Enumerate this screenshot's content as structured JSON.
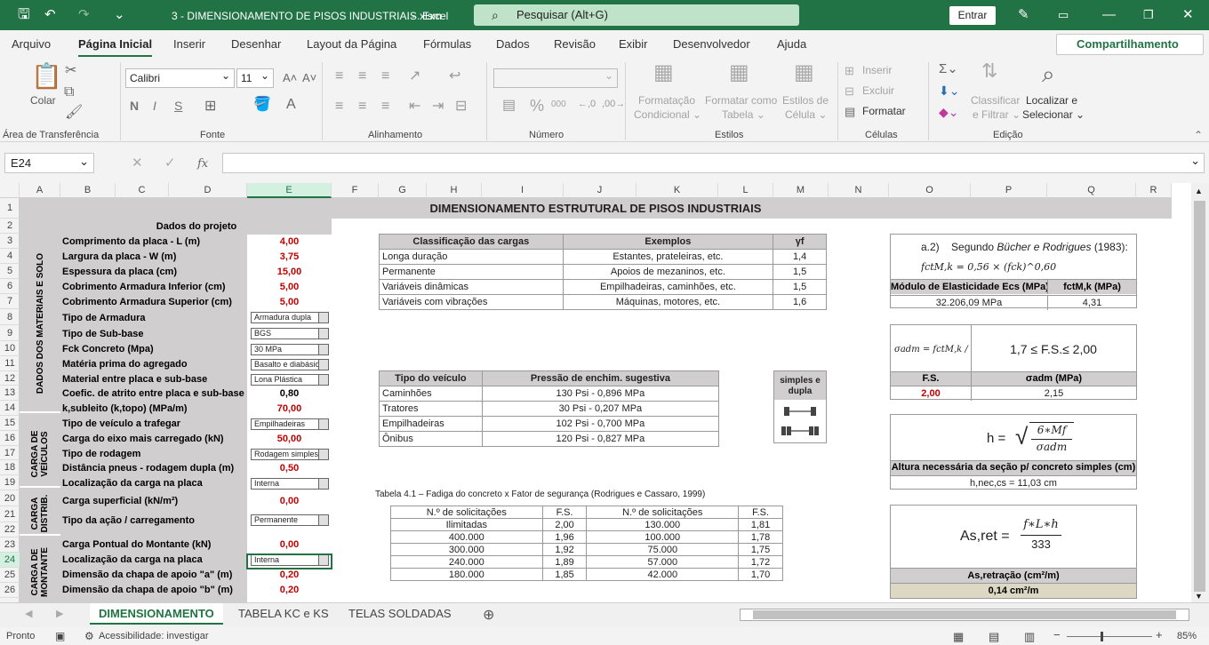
{
  "title": {
    "file": "3 - DIMENSIONAMENTO DE PISOS INDUSTRIAIS.xlsm",
    "sep": "-",
    "app": "Excel",
    "search": "Pesquisar (Alt+G)",
    "entrar": "Entrar"
  },
  "menu": [
    "Arquivo",
    "Página Inicial",
    "Inserir",
    "Desenhar",
    "Layout da Página",
    "Fórmulas",
    "Dados",
    "Revisão",
    "Exibir",
    "Desenvolvedor",
    "Ajuda"
  ],
  "share": "Compartilhamento",
  "ribbon": {
    "colar": "Colar",
    "font": "Calibri",
    "size": "11",
    "bold": "N",
    "italic": "I",
    "underline": "S",
    "pct": "%",
    "thousands": "000",
    "fmt_cond": [
      "Formatação",
      "Condicional ⌄"
    ],
    "fmt_tab": [
      "Formatar como",
      "Tabela ⌄"
    ],
    "styles": [
      "Estilos de",
      "Célula ⌄"
    ],
    "inserir": "Inserir",
    "excluir": "Excluir",
    "formatar": "Formatar",
    "classificar": [
      "Classificar",
      "e Filtrar ⌄"
    ],
    "localizar": [
      "Localizar e",
      "Selecionar ⌄"
    ],
    "groups": [
      "Área de Transferência",
      "Fonte",
      "Alinhamento",
      "Número",
      "Estilos",
      "Células",
      "Edição"
    ]
  },
  "namebox": "E24",
  "fx": "fx",
  "columns": [
    "A",
    "B",
    "C",
    "D",
    "E",
    "F",
    "G",
    "H",
    "I",
    "J",
    "K",
    "L",
    "M",
    "N",
    "O",
    "P",
    "Q",
    "R"
  ],
  "rows": [
    "1",
    "2",
    "3",
    "4",
    "5",
    "6",
    "7",
    "8",
    "9",
    "10",
    "11",
    "12",
    "13",
    "14",
    "15",
    "16",
    "17",
    "18",
    "19",
    "20",
    "21",
    "22",
    "23",
    "24",
    "25",
    "26"
  ],
  "sheet": {
    "main_title": "DIMENSIONAMENTO ESTRUTURAL DE PISOS INDUSTRIAIS",
    "project_header": "Dados do projeto",
    "side_materials": "DADOS DOS MATERIAIS E SOLO",
    "side_vehicles": "CARGA DE VEÍCULOS",
    "side_distrib": "CARGA DISTRIB.",
    "side_montante": "CARGA DE MONTANTE",
    "inputs": [
      {
        "label": "Comprimento da placa - L (m)",
        "value": "4,00"
      },
      {
        "label": "Largura da placa - W (m)",
        "value": "3,75"
      },
      {
        "label": "Espessura da placa (cm)",
        "value": "15,00"
      },
      {
        "label": "Cobrimento Armadura Inferior (cm)",
        "value": "5,00"
      },
      {
        "label": "Cobrimento Armadura Superior (cm)",
        "value": "5,00"
      },
      {
        "label": "Tipo de Armadura",
        "dropdown": "Armadura dupla"
      },
      {
        "label": "Tipo de Sub-base",
        "dropdown": "BGS"
      },
      {
        "label": "Fck Concreto (Mpa)",
        "dropdown": "30 MPa"
      },
      {
        "label": "Matéria prima do agregado",
        "dropdown": "Basalto e diabásio"
      },
      {
        "label": "Material entre placa e sub-base",
        "dropdown": "Lona Plástica"
      },
      {
        "label": "Coefic. de atrito entre placa e sub-base",
        "value": "0,80",
        "black": true
      },
      {
        "label": "k,subleito (k,topo) (MPa/m)",
        "value": "70,00"
      },
      {
        "label": "Tipo de veículo a trafegar",
        "dropdown": "Empilhadeiras"
      },
      {
        "label": "Carga do eixo mais carregado (kN)",
        "value": "50,00"
      },
      {
        "label": "Tipo de rodagem",
        "dropdown": "Rodagem simples"
      },
      {
        "label": "Distância pneus - rodagem dupla (m)",
        "value": "0,50"
      },
      {
        "label": "Localização da carga na placa",
        "dropdown": "Interna"
      },
      {
        "label": "Carga superficial (kN/m²)",
        "value": "0,00"
      },
      {
        "label": "Tipo da ação / carregamento",
        "dropdown": "Permanente"
      },
      {
        "label": "Carga Pontual do Montante (kN)",
        "value": "0,00"
      },
      {
        "label": "Localização da carga na placa",
        "dropdown": "Interna"
      },
      {
        "label": "Dimensão da chapa de apoio \"a\" (m)",
        "value": "0,20"
      },
      {
        "label": "Dimensão da chapa de apoio \"b\" (m)",
        "value": "0,20"
      }
    ],
    "class_table": {
      "headers": [
        "Classificação das cargas",
        "Exemplos",
        "γf"
      ],
      "rows": [
        [
          "Longa duração",
          "Estantes, prateleiras, etc.",
          "1,4"
        ],
        [
          "Permanente",
          "Apoios de mezaninos, etc.",
          "1,5"
        ],
        [
          "Variáveis dinâmicas",
          "Empilhadeiras, caminhões, etc.",
          "1,5"
        ],
        [
          "Variáveis com vibrações",
          "Máquinas,  motores, etc.",
          "1,6"
        ]
      ]
    },
    "vehicle_table": {
      "headers": [
        "Tipo do veículo",
        "Pressão de enchim. sugestiva"
      ],
      "rows": [
        [
          "Caminhões",
          "130 Psi - 0,896 MPa"
        ],
        [
          "Tratores",
          "30 Psi - 0,207 MPa"
        ],
        [
          "Empilhadeiras",
          "102 Psi - 0,700 MPa"
        ],
        [
          "Ônibus",
          "120 Psi - 0,827 MPa"
        ]
      ]
    },
    "wheel_box": "simples e dupla",
    "fatigue_title": "Tabela 4.1 – Fadiga do concreto x Fator de segurança (Rodrigues e Cassaro, 1999)",
    "fatigue_table": {
      "headers": [
        "N.º de solicitações",
        "F.S.",
        "N.º de solicitações",
        "F.S."
      ],
      "rows": [
        [
          "Ilimitadas",
          "2,00",
          "130.000",
          "1,81"
        ],
        [
          "400.000",
          "1,96",
          "100.000",
          "1,78"
        ],
        [
          "300.000",
          "1,92",
          "75.000",
          "1,75"
        ],
        [
          "240.000",
          "1,89",
          "57.000",
          "1,72"
        ],
        [
          "180.000",
          "1,85",
          "42.000",
          "1,70"
        ]
      ]
    },
    "panel_a": {
      "heading": "a.2)",
      "heading_text": "Segundo",
      "authors": "Bücher e Rodrigues",
      "year": "(1983):",
      "formula": "fctM,k = 0,56 × (fck)^0,60",
      "h1": "Módulo de Elasticidade Ecs (MPa)",
      "h2": "fctM,k (MPa)",
      "v1": "32.206,09 MPa",
      "v2": "4,31"
    },
    "panel_b": {
      "formula": "σadm = fctM,k / F.S.",
      "range": "1,7 ≤ F.S.≤ 2,00",
      "h1": "F.S.",
      "h2": "σadm (MPa)",
      "v1": "2,00",
      "v2": "2,15"
    },
    "panel_c": {
      "formula_lhs": "h =",
      "num": "6∗Mf",
      "den": "σadm",
      "h1": "Altura necessária da seção p/ concreto simples (cm)",
      "v1": "h,nec,cs = 11,03 cm"
    },
    "panel_d": {
      "formula_lhs": "As,ret =",
      "num": "f∗L∗h",
      "den": "333",
      "h1": "As,retração (cm²/m)",
      "v1": "0,14 cm²/m"
    }
  },
  "tabs": [
    "DIMENSIONAMENTO",
    "TABELA KC e KS",
    "TELAS SOLDADAS"
  ],
  "status": {
    "ready": "Pronto",
    "access": "Acessibilidade: investigar",
    "zoom": "85%"
  }
}
